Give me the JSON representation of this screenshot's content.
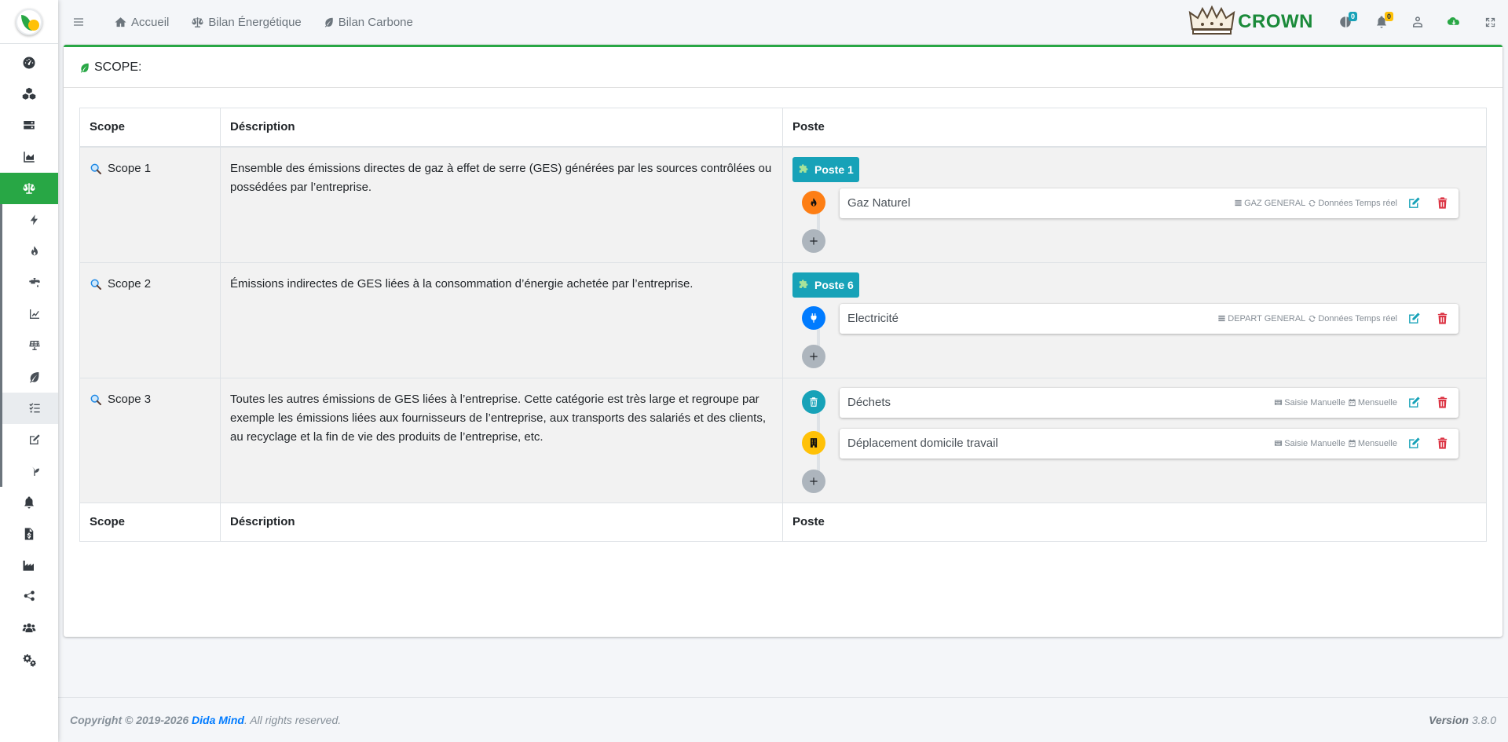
{
  "navbar": {
    "links": [
      {
        "label": "Accueil",
        "icon": "home-icon"
      },
      {
        "label": "Bilan Énergétique",
        "icon": "balance-scale-icon"
      },
      {
        "label": "Bilan Carbone",
        "icon": "leaf-icon"
      }
    ],
    "brand_name": "CROWN",
    "badges": {
      "messages": "0",
      "notifications": "0"
    }
  },
  "sidebar": {
    "items": [
      {
        "icon": "dashboard-gauge-icon"
      },
      {
        "icon": "cubes-icon"
      },
      {
        "icon": "server-icon"
      },
      {
        "icon": "area-chart-icon"
      },
      {
        "icon": "balance-scale-icon",
        "active": true
      },
      {
        "icon": "bolt-icon",
        "sub": true
      },
      {
        "icon": "fire-icon",
        "sub": true
      },
      {
        "icon": "faucet-icon",
        "sub": true
      },
      {
        "icon": "line-chart-icon",
        "sub": true
      },
      {
        "icon": "solar-panel-icon",
        "sub": true
      },
      {
        "icon": "leaf-icon",
        "sub": true
      },
      {
        "icon": "tasks-icon",
        "sub": true,
        "current": true
      },
      {
        "icon": "edit-icon",
        "sub": true
      },
      {
        "icon": "seedling-icon",
        "sub": true
      },
      {
        "icon": "bell-icon"
      },
      {
        "icon": "invoice-icon"
      },
      {
        "icon": "industry-icon"
      },
      {
        "icon": "share-icon"
      },
      {
        "icon": "users-icon"
      },
      {
        "icon": "cogs-icon"
      }
    ]
  },
  "card": {
    "title": "SCOPE:"
  },
  "table": {
    "headers": {
      "scope": "Scope",
      "description": "Déscription",
      "poste": "Poste"
    },
    "rows": [
      {
        "scope": "Scope 1",
        "description": "Ensemble des émissions directes de gaz à effet de serre (GES) générées par les sources contrôlées ou possédées par l’entreprise.",
        "poste_badge": "Poste 1",
        "items": [
          {
            "name": "Gaz Naturel",
            "meta1": "GAZ GENERAL",
            "meta2": "Données Temps réel",
            "icon": "fire-icon",
            "color": "#fd7e14"
          }
        ]
      },
      {
        "scope": "Scope 2",
        "description": "Émissions indirectes de GES liées à la consommation d’énergie achetée par l’entreprise.",
        "poste_badge": "Poste 6",
        "items": [
          {
            "name": "Electricité",
            "meta1": "DEPART GENERAL",
            "meta2": "Données Temps réel",
            "icon": "plug-icon",
            "color": "#007bff"
          }
        ]
      },
      {
        "scope": "Scope 3",
        "description": "Toutes les autres émissions de GES liées à l’entreprise. Cette catégorie est très large et regroupe par exemple les émissions liées aux fournisseurs de l’entreprise, aux transports des salariés et des clients, au recyclage et la fin de vie des produits de l’entreprise, etc.",
        "poste_badge": "",
        "items": [
          {
            "name": "Déchets",
            "meta1": "Saisie Manuelle",
            "meta2": "Mensuelle",
            "icon": "trash-icon",
            "color": "#17a2b8"
          },
          {
            "name": "Déplacement domicile travail",
            "meta1": "Saisie Manuelle",
            "meta2": "Mensuelle",
            "icon": "building-icon",
            "color": "#ffc107"
          }
        ]
      }
    ]
  },
  "footer": {
    "copyright_prefix": "Copyright © 2019-2026 ",
    "company": "Dida Mind",
    "rights": ". All rights reserved.",
    "version_label": "Version",
    "version": "3.8.0"
  }
}
